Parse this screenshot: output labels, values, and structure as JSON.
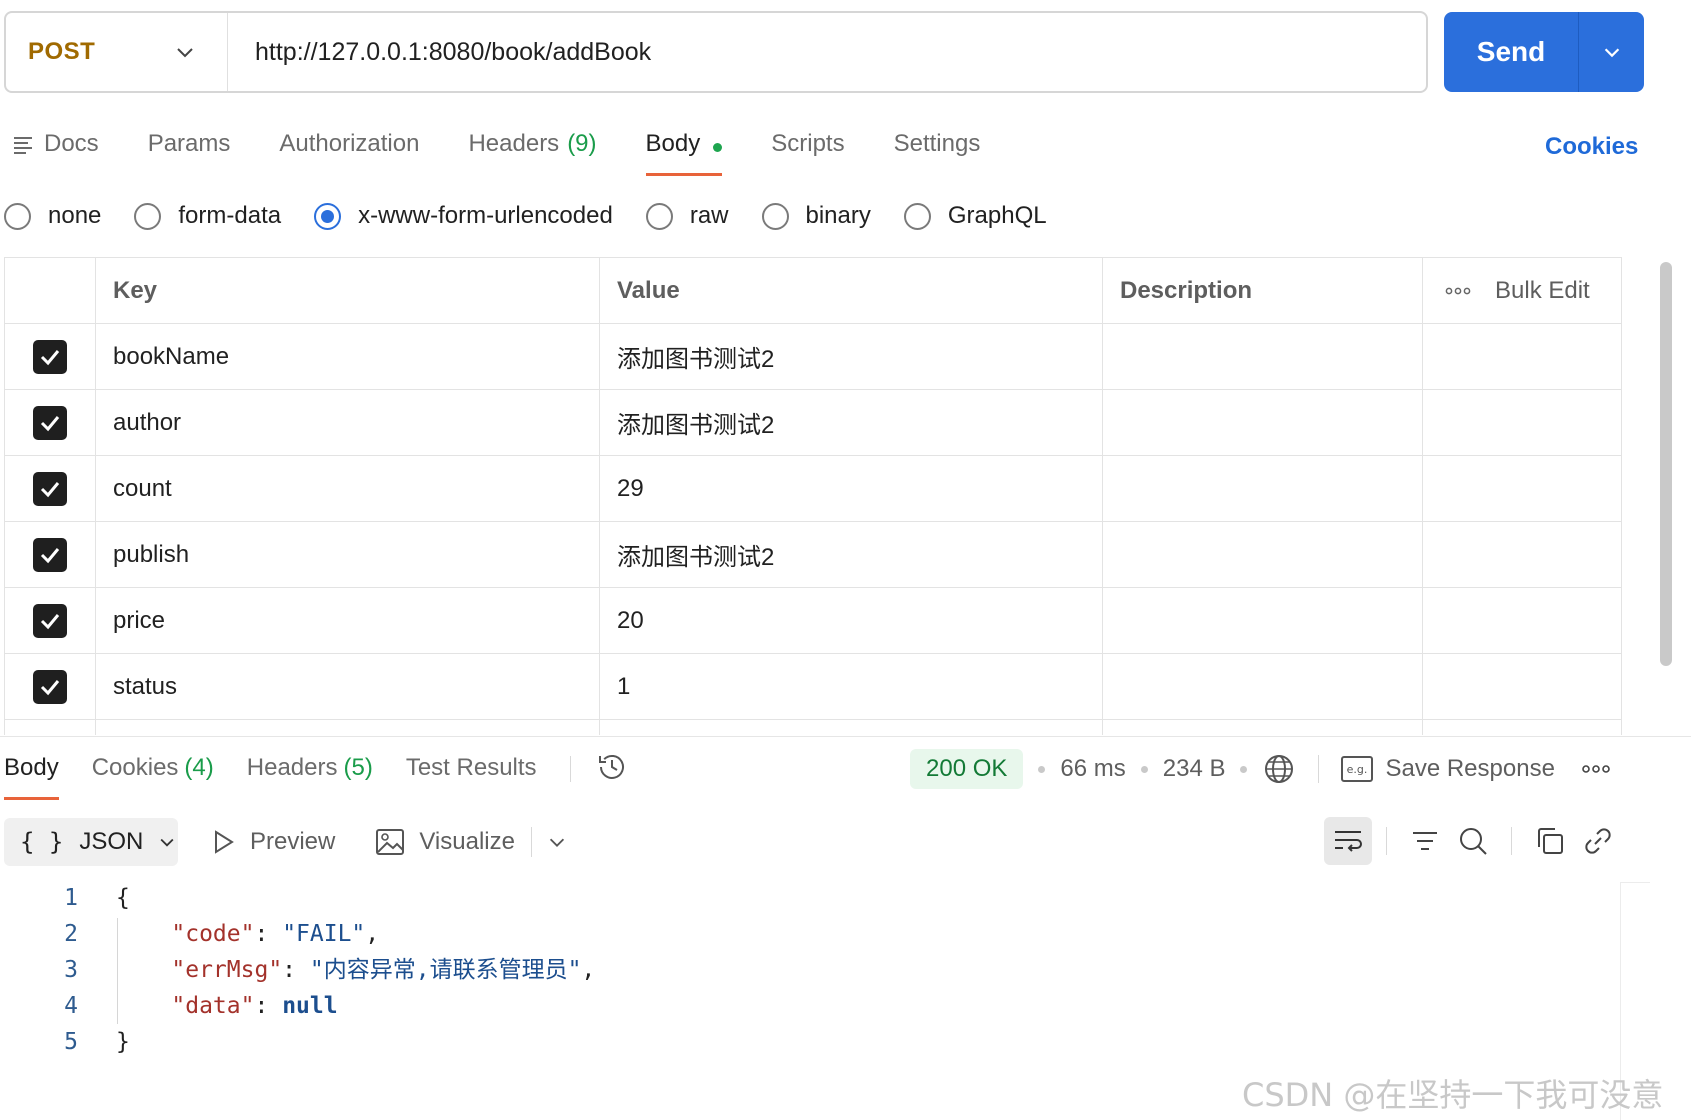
{
  "request": {
    "method": "POST",
    "url": "http://127.0.0.1:8080/book/addBook",
    "send_label": "Send"
  },
  "tabs": [
    {
      "label": "Docs"
    },
    {
      "label": "Params"
    },
    {
      "label": "Authorization"
    },
    {
      "label": "Headers",
      "count": "(9)"
    },
    {
      "label": "Body"
    },
    {
      "label": "Scripts"
    },
    {
      "label": "Settings"
    }
  ],
  "cookies_label": "Cookies",
  "body_types": [
    "none",
    "form-data",
    "x-www-form-urlencoded",
    "raw",
    "binary",
    "GraphQL"
  ],
  "selected_body_type": "x-www-form-urlencoded",
  "params": {
    "headers": {
      "key": "Key",
      "value": "Value",
      "description": "Description",
      "bulk_edit": "Bulk Edit"
    },
    "rows": [
      {
        "key": "bookName",
        "value": "添加图书测试2",
        "checked": true
      },
      {
        "key": "author",
        "value": "添加图书测试2",
        "checked": true
      },
      {
        "key": "count",
        "value": "29",
        "checked": true
      },
      {
        "key": "publish",
        "value": "添加图书测试2",
        "checked": true
      },
      {
        "key": "price",
        "value": "20",
        "checked": true
      },
      {
        "key": "status",
        "value": "1",
        "checked": true
      }
    ]
  },
  "response": {
    "tabs": [
      {
        "label": "Body"
      },
      {
        "label": "Cookies",
        "count": "(4)"
      },
      {
        "label": "Headers",
        "count": "(5)"
      },
      {
        "label": "Test Results"
      }
    ],
    "status": "200 OK",
    "time": "66 ms",
    "size": "234 B",
    "save_response": "Save Response",
    "format": "JSON",
    "preview": "Preview",
    "visualize": "Visualize",
    "code": {
      "line_numbers": [
        "1",
        "2",
        "3",
        "4",
        "5"
      ],
      "open_brace": "{",
      "close_brace": "}",
      "fields": [
        {
          "key": "\"code\"",
          "value": "\"FAIL\"",
          "trail": ","
        },
        {
          "key": "\"errMsg\"",
          "value": "\"内容异常,请联系管理员\"",
          "trail": ","
        },
        {
          "key": "\"data\"",
          "value": "null",
          "trail": ""
        }
      ]
    }
  },
  "watermark": "CSDN @在坚持一下我可没意见"
}
